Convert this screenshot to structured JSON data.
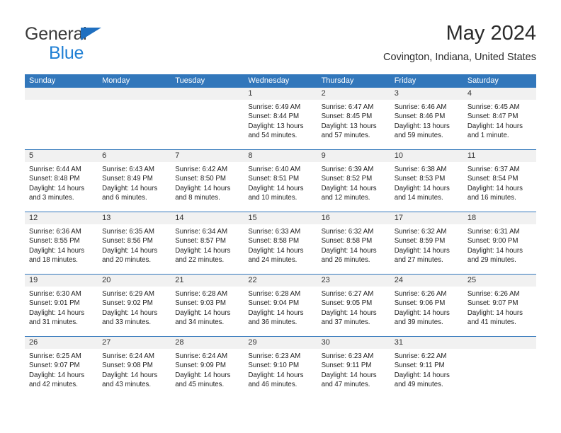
{
  "brand": {
    "line1": "General",
    "line2": "Blue",
    "triangle_color": "#1f6fc0",
    "line2_color": "#1f7fd4"
  },
  "header": {
    "title": "May 2024",
    "location": "Covington, Indiana, United States"
  },
  "theme": {
    "header_bg": "#3277bb",
    "header_text": "#ffffff",
    "daynum_bg": "#f1f1f1",
    "cell_bg": "#ffffff",
    "row_divider": "#3277bb"
  },
  "weekdays": [
    "Sunday",
    "Monday",
    "Tuesday",
    "Wednesday",
    "Thursday",
    "Friday",
    "Saturday"
  ],
  "labels": {
    "sunrise_prefix": "Sunrise:",
    "sunset_prefix": "Sunset:",
    "daylight_prefix": "Daylight:"
  },
  "weeks": [
    [
      {
        "empty": true
      },
      {
        "empty": true
      },
      {
        "empty": true
      },
      {
        "day": "1",
        "sunrise": "Sunrise: 6:49 AM",
        "sunset": "Sunset: 8:44 PM",
        "daylight_l1": "Daylight: 13 hours",
        "daylight_l2": "and 54 minutes."
      },
      {
        "day": "2",
        "sunrise": "Sunrise: 6:47 AM",
        "sunset": "Sunset: 8:45 PM",
        "daylight_l1": "Daylight: 13 hours",
        "daylight_l2": "and 57 minutes."
      },
      {
        "day": "3",
        "sunrise": "Sunrise: 6:46 AM",
        "sunset": "Sunset: 8:46 PM",
        "daylight_l1": "Daylight: 13 hours",
        "daylight_l2": "and 59 minutes."
      },
      {
        "day": "4",
        "sunrise": "Sunrise: 6:45 AM",
        "sunset": "Sunset: 8:47 PM",
        "daylight_l1": "Daylight: 14 hours",
        "daylight_l2": "and 1 minute."
      }
    ],
    [
      {
        "day": "5",
        "sunrise": "Sunrise: 6:44 AM",
        "sunset": "Sunset: 8:48 PM",
        "daylight_l1": "Daylight: 14 hours",
        "daylight_l2": "and 3 minutes."
      },
      {
        "day": "6",
        "sunrise": "Sunrise: 6:43 AM",
        "sunset": "Sunset: 8:49 PM",
        "daylight_l1": "Daylight: 14 hours",
        "daylight_l2": "and 6 minutes."
      },
      {
        "day": "7",
        "sunrise": "Sunrise: 6:42 AM",
        "sunset": "Sunset: 8:50 PM",
        "daylight_l1": "Daylight: 14 hours",
        "daylight_l2": "and 8 minutes."
      },
      {
        "day": "8",
        "sunrise": "Sunrise: 6:40 AM",
        "sunset": "Sunset: 8:51 PM",
        "daylight_l1": "Daylight: 14 hours",
        "daylight_l2": "and 10 minutes."
      },
      {
        "day": "9",
        "sunrise": "Sunrise: 6:39 AM",
        "sunset": "Sunset: 8:52 PM",
        "daylight_l1": "Daylight: 14 hours",
        "daylight_l2": "and 12 minutes."
      },
      {
        "day": "10",
        "sunrise": "Sunrise: 6:38 AM",
        "sunset": "Sunset: 8:53 PM",
        "daylight_l1": "Daylight: 14 hours",
        "daylight_l2": "and 14 minutes."
      },
      {
        "day": "11",
        "sunrise": "Sunrise: 6:37 AM",
        "sunset": "Sunset: 8:54 PM",
        "daylight_l1": "Daylight: 14 hours",
        "daylight_l2": "and 16 minutes."
      }
    ],
    [
      {
        "day": "12",
        "sunrise": "Sunrise: 6:36 AM",
        "sunset": "Sunset: 8:55 PM",
        "daylight_l1": "Daylight: 14 hours",
        "daylight_l2": "and 18 minutes."
      },
      {
        "day": "13",
        "sunrise": "Sunrise: 6:35 AM",
        "sunset": "Sunset: 8:56 PM",
        "daylight_l1": "Daylight: 14 hours",
        "daylight_l2": "and 20 minutes."
      },
      {
        "day": "14",
        "sunrise": "Sunrise: 6:34 AM",
        "sunset": "Sunset: 8:57 PM",
        "daylight_l1": "Daylight: 14 hours",
        "daylight_l2": "and 22 minutes."
      },
      {
        "day": "15",
        "sunrise": "Sunrise: 6:33 AM",
        "sunset": "Sunset: 8:58 PM",
        "daylight_l1": "Daylight: 14 hours",
        "daylight_l2": "and 24 minutes."
      },
      {
        "day": "16",
        "sunrise": "Sunrise: 6:32 AM",
        "sunset": "Sunset: 8:58 PM",
        "daylight_l1": "Daylight: 14 hours",
        "daylight_l2": "and 26 minutes."
      },
      {
        "day": "17",
        "sunrise": "Sunrise: 6:32 AM",
        "sunset": "Sunset: 8:59 PM",
        "daylight_l1": "Daylight: 14 hours",
        "daylight_l2": "and 27 minutes."
      },
      {
        "day": "18",
        "sunrise": "Sunrise: 6:31 AM",
        "sunset": "Sunset: 9:00 PM",
        "daylight_l1": "Daylight: 14 hours",
        "daylight_l2": "and 29 minutes."
      }
    ],
    [
      {
        "day": "19",
        "sunrise": "Sunrise: 6:30 AM",
        "sunset": "Sunset: 9:01 PM",
        "daylight_l1": "Daylight: 14 hours",
        "daylight_l2": "and 31 minutes."
      },
      {
        "day": "20",
        "sunrise": "Sunrise: 6:29 AM",
        "sunset": "Sunset: 9:02 PM",
        "daylight_l1": "Daylight: 14 hours",
        "daylight_l2": "and 33 minutes."
      },
      {
        "day": "21",
        "sunrise": "Sunrise: 6:28 AM",
        "sunset": "Sunset: 9:03 PM",
        "daylight_l1": "Daylight: 14 hours",
        "daylight_l2": "and 34 minutes."
      },
      {
        "day": "22",
        "sunrise": "Sunrise: 6:28 AM",
        "sunset": "Sunset: 9:04 PM",
        "daylight_l1": "Daylight: 14 hours",
        "daylight_l2": "and 36 minutes."
      },
      {
        "day": "23",
        "sunrise": "Sunrise: 6:27 AM",
        "sunset": "Sunset: 9:05 PM",
        "daylight_l1": "Daylight: 14 hours",
        "daylight_l2": "and 37 minutes."
      },
      {
        "day": "24",
        "sunrise": "Sunrise: 6:26 AM",
        "sunset": "Sunset: 9:06 PM",
        "daylight_l1": "Daylight: 14 hours",
        "daylight_l2": "and 39 minutes."
      },
      {
        "day": "25",
        "sunrise": "Sunrise: 6:26 AM",
        "sunset": "Sunset: 9:07 PM",
        "daylight_l1": "Daylight: 14 hours",
        "daylight_l2": "and 41 minutes."
      }
    ],
    [
      {
        "day": "26",
        "sunrise": "Sunrise: 6:25 AM",
        "sunset": "Sunset: 9:07 PM",
        "daylight_l1": "Daylight: 14 hours",
        "daylight_l2": "and 42 minutes."
      },
      {
        "day": "27",
        "sunrise": "Sunrise: 6:24 AM",
        "sunset": "Sunset: 9:08 PM",
        "daylight_l1": "Daylight: 14 hours",
        "daylight_l2": "and 43 minutes."
      },
      {
        "day": "28",
        "sunrise": "Sunrise: 6:24 AM",
        "sunset": "Sunset: 9:09 PM",
        "daylight_l1": "Daylight: 14 hours",
        "daylight_l2": "and 45 minutes."
      },
      {
        "day": "29",
        "sunrise": "Sunrise: 6:23 AM",
        "sunset": "Sunset: 9:10 PM",
        "daylight_l1": "Daylight: 14 hours",
        "daylight_l2": "and 46 minutes."
      },
      {
        "day": "30",
        "sunrise": "Sunrise: 6:23 AM",
        "sunset": "Sunset: 9:11 PM",
        "daylight_l1": "Daylight: 14 hours",
        "daylight_l2": "and 47 minutes."
      },
      {
        "day": "31",
        "sunrise": "Sunrise: 6:22 AM",
        "sunset": "Sunset: 9:11 PM",
        "daylight_l1": "Daylight: 14 hours",
        "daylight_l2": "and 49 minutes."
      },
      {
        "empty": true
      }
    ]
  ]
}
